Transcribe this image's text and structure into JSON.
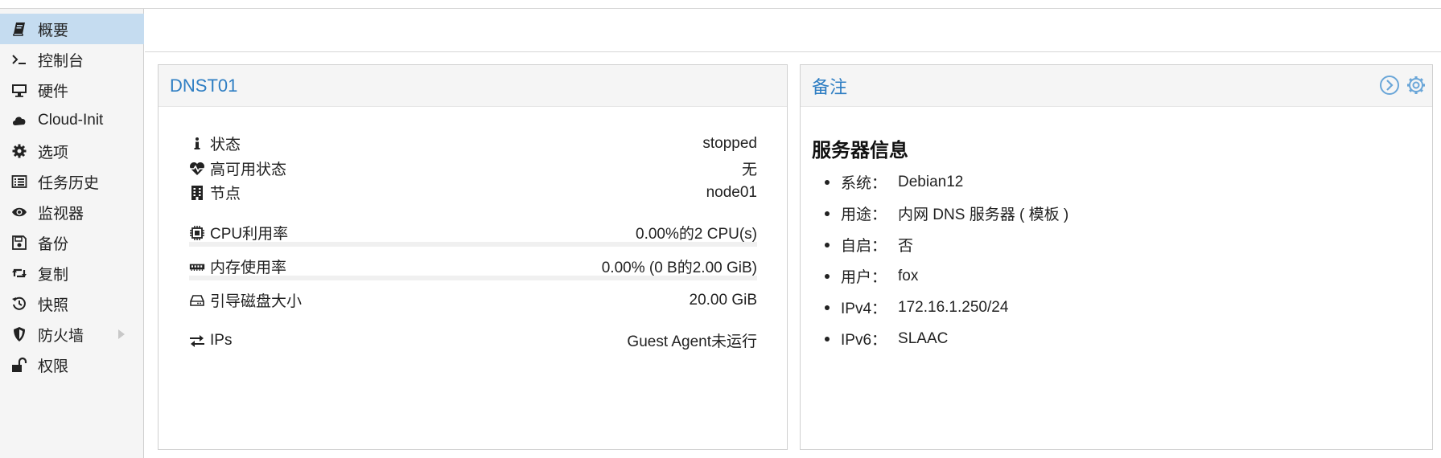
{
  "sidebar": {
    "items": [
      {
        "label": "概要",
        "icon": "book-icon"
      },
      {
        "label": "控制台",
        "icon": "terminal-icon"
      },
      {
        "label": "硬件",
        "icon": "desktop-icon"
      },
      {
        "label": "Cloud-Init",
        "icon": "cloud-icon"
      },
      {
        "label": "选项",
        "icon": "gear-icon"
      },
      {
        "label": "任务历史",
        "icon": "list-icon"
      },
      {
        "label": "监视器",
        "icon": "eye-icon"
      },
      {
        "label": "备份",
        "icon": "floppy-icon"
      },
      {
        "label": "复制",
        "icon": "retweet-icon"
      },
      {
        "label": "快照",
        "icon": "history-icon"
      },
      {
        "label": "防火墙",
        "icon": "shield-icon"
      },
      {
        "label": "权限",
        "icon": "unlock-icon"
      }
    ],
    "active_index": 0
  },
  "status_panel": {
    "title": "DNST01",
    "rows": [
      {
        "label": "状态",
        "value": "stopped",
        "icon": "info-icon"
      },
      {
        "label": "高可用状态",
        "value": "无",
        "icon": "heartbeat-icon"
      },
      {
        "label": "节点",
        "value": "node01",
        "icon": "building-icon"
      },
      {
        "label": "CPU利用率",
        "value": "0.00%的2 CPU(s)",
        "icon": "cpu-icon"
      },
      {
        "label": "内存使用率",
        "value": "0.00% (0 B的2.00 GiB)",
        "icon": "memory-icon"
      },
      {
        "label": "引导磁盘大小",
        "value": "20.00 GiB",
        "icon": "hdd-icon"
      },
      {
        "label": "IPs",
        "value": "Guest Agent未运行",
        "icon": "exchange-icon"
      }
    ]
  },
  "notes_panel": {
    "title": "备注",
    "heading": "服务器信息",
    "items": [
      {
        "key": "系统：",
        "value": "Debian12"
      },
      {
        "key": "用途：",
        "value": "内网 DNS 服务器 ( 模板 )"
      },
      {
        "key": "自启：",
        "value": "否"
      },
      {
        "key": "用户：",
        "value": "fox"
      },
      {
        "key": "IPv4：",
        "value": "172.16.1.250/24"
      },
      {
        "key": "IPv6：",
        "value": "SLAAC"
      }
    ]
  },
  "colors": {
    "accent": "#2e7ec3",
    "active_bg": "#c5dcf0",
    "tool_icon": "#6aa6d8"
  }
}
